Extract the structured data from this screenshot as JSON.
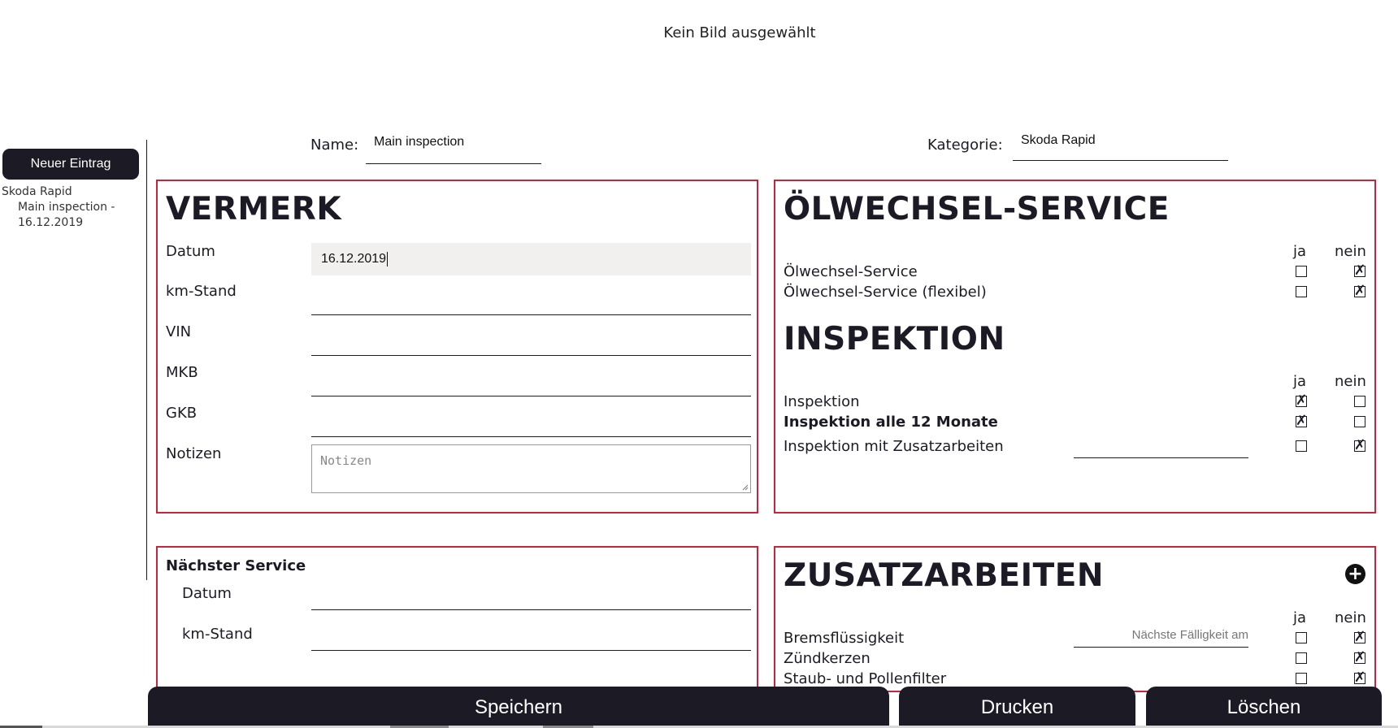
{
  "banner": {
    "text": "Kein Bild ausgewählt"
  },
  "sidebar": {
    "new_button": "Neuer Eintrag",
    "group": "Skoda Rapid",
    "entry_line1": "Main inspection -",
    "entry_line2": "16.12.2019"
  },
  "header": {
    "name_label": "Name:",
    "name_value": "Main inspection",
    "category_label": "Kategorie:",
    "category_value": "Skoda Rapid"
  },
  "vermerk": {
    "title": "VERMERK",
    "datum_label": "Datum",
    "datum_value": "16.12.2019",
    "km_label": "km-Stand",
    "vin_label": "VIN",
    "mkb_label": "MKB",
    "gkb_label": "GKB",
    "notes_label": "Notizen",
    "notes_placeholder": "Notizen"
  },
  "oil": {
    "title": "ÖLWECHSEL-SERVICE",
    "yes": "ja",
    "no": "nein",
    "rows": [
      {
        "label": "Ölwechsel-Service",
        "ja": false,
        "nein": true
      },
      {
        "label": "Ölwechsel-Service (flexibel)",
        "ja": false,
        "nein": true
      }
    ]
  },
  "inspection": {
    "title": "INSPEKTION",
    "yes": "ja",
    "no": "nein",
    "rows": [
      {
        "label": "Inspektion",
        "ja": true,
        "nein": false
      },
      {
        "label": "Inspektion alle 12 Monate",
        "ja": true,
        "nein": false
      },
      {
        "label": "Inspektion mit Zusatzarbeiten",
        "ja": false,
        "nein": true
      }
    ]
  },
  "next_service": {
    "title": "Nächster Service",
    "datum_label": "Datum",
    "km_label": "km-Stand"
  },
  "extra": {
    "title": "ZUSATZARBEITEN",
    "yes": "ja",
    "no": "nein",
    "due_placeholder": "Nächste Fälligkeit am",
    "rows": [
      {
        "label": "Bremsflüssigkeit",
        "ja": false,
        "nein": true
      },
      {
        "label": "Zündkerzen",
        "ja": false,
        "nein": true
      },
      {
        "label": "Staub- und Pollenfilter",
        "ja": false,
        "nein": true
      }
    ]
  },
  "actions": {
    "save": "Speichern",
    "print": "Drucken",
    "delete": "Löschen"
  },
  "colors": {
    "accent_border": "#c8253d",
    "dark": "#1c1b25",
    "input_bg": "#f2f0ee"
  }
}
